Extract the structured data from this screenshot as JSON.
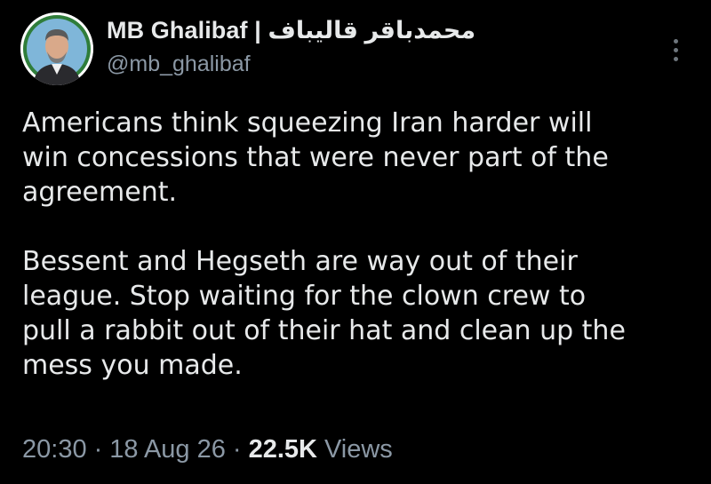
{
  "author": {
    "display_name": "MB Ghalibaf | محمدباقر قالیباف",
    "handle": "@mb_ghalibaf"
  },
  "tweet": {
    "paragraphs": [
      "Americans think squeezing Iran harder will\nwin concessions that were never part of the\nagreement.",
      "Bessent and Hegseth are way out of their\nleague. Stop waiting for the clown crew to\npull a rabbit out of their hat and clean up the\nmess you made."
    ]
  },
  "meta": {
    "time": "20:30",
    "separator": "·",
    "date": "18 Aug 26",
    "views_count": "22.5K",
    "views_label": "Views"
  },
  "icons": {
    "more": "more-vertical-icon",
    "avatar": "profile-photo"
  },
  "colors": {
    "background": "#000000",
    "primary_text": "#e7e9ea",
    "secondary_text": "#8b98a5"
  }
}
